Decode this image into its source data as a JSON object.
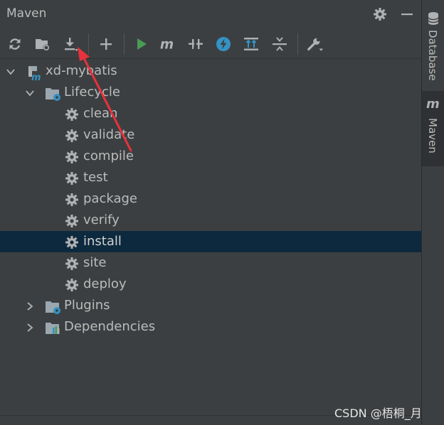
{
  "panel": {
    "title": "Maven"
  },
  "tree": {
    "project": "xd-mybatis",
    "lifecycle": {
      "label": "Lifecycle",
      "goals": [
        "clean",
        "validate",
        "compile",
        "test",
        "package",
        "verify",
        "install",
        "site",
        "deploy"
      ],
      "selected": "install"
    },
    "plugins": "Plugins",
    "dependencies": "Dependencies"
  },
  "right_strip": {
    "database_tab": "Database",
    "maven_tab": "Maven"
  },
  "watermark": "CSDN @梧桐_月",
  "colors": {
    "background": "#3c3f41",
    "selection": "#0d293e",
    "run_green": "#499c54",
    "accent_blue": "#3592c4",
    "annotation_red": "#e8323c"
  }
}
